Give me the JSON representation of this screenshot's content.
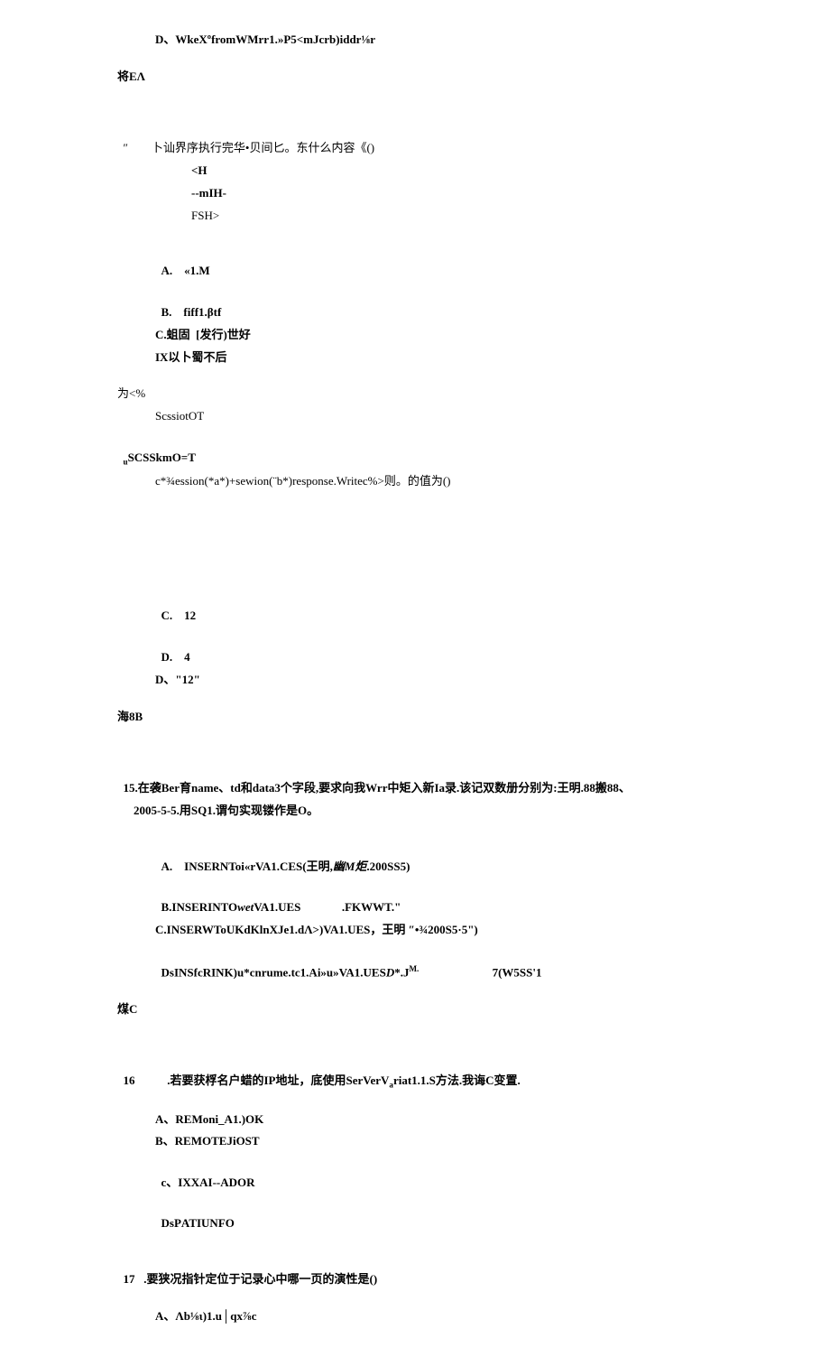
{
  "l1": "D、WkeXºfromWMrr1.»P5<mJcrb)iddr⅛r",
  "l2": "将EΛ",
  "q14": {
    "stem_prefix": "″",
    "stem": "卜讪界序执行完华•贝间匕。东什么内容《()",
    "code1": "<H",
    "code2": "--mIH-",
    "code3": "FSH>",
    "optA_label": "A.",
    "optA": "«1.M",
    "optB_label": "B.",
    "optB": "fiff1.βtf",
    "optC": "C.蛆固  [发行)世好",
    "optD": "IX以卜蜀不后"
  },
  "mid1": "为<%",
  "mid2": "ScssiotOT",
  "mid3_label": "u",
  "mid3": "SCSSkmO=T",
  "mid4": "c*¾ession(*a*)+sewion(¨b*)response.Writec%>则。的值为()",
  "opts2": {
    "c_label": "C.",
    "c": "12",
    "d_label": "D.",
    "d": "4",
    "d2": "D、\"12\""
  },
  "ans1": "海8B",
  "q15": {
    "num": "15",
    "stem1": ".在袭Ber育name、td和data3个字段,要求向我Wrr中矩入新Ia录.该记双数册分别为:王明.88搬88、",
    "stem2": "2005-5-5.用SQ1.谓句实现镂作是O。",
    "optA_label": "A.",
    "optA_p1": "INSERNToi«rVA1.CES(王明,",
    "optA_p2": "幽M炬",
    "optA_p3": ".200SS5)",
    "optB_p1": "B.INSERINTO",
    "optB_p2": "wet",
    "optB_p3": "VA1.UES",
    "optB_p4": ".FKWWT.\"",
    "optC": "C.INSERWToUKdKlnXJe1.dΛ>)VA1.UES，王明 ″•¾200S5·5\")",
    "optD_p1": "DsINSfcRINK)u*cnrume.tc1.Ai»u»VA1.UES",
    "optD_p2": "D",
    "optD_p3": "*.J",
    "optD_sup": "M.",
    "optD_p4": "7(W5SS'1"
  },
  "ans2": "煤C",
  "q16": {
    "num": "16",
    "stem_p1": ".若要获桴名户蜡的IP地址，底使用SerVerV",
    "stem_sub": "a",
    "stem_p2": "riat1.1.S方法.我诲C变置.",
    "optA": "A、REMoni_A1.)OK",
    "optB": "B、REMOTEJiOST",
    "optC_p1": "c、I",
    "optC_p2": "XXAI",
    "optC_p3": "--ADOR",
    "optD_p1": "DsP",
    "optD_p2": "ATIUNFO"
  },
  "q17": {
    "num": "17",
    "stem": ".要狭况指针定位于记录心中哪一页的演性是()",
    "optA": "A、Λb⅛ι)1.u│qx⅞c"
  }
}
